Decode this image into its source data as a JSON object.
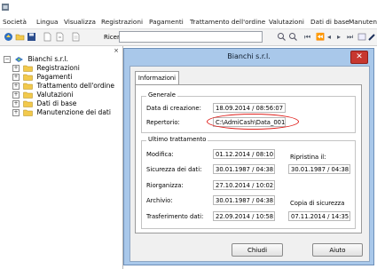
{
  "menu": {
    "items": [
      "Società",
      "Lingua",
      "Visualizza",
      "Registrazioni",
      "Pagamenti",
      "Trattamento dell'ordine",
      "Valutazioni",
      "Dati di base",
      "Manuten"
    ]
  },
  "toolbar": {
    "search_label": "Ricerca:",
    "search_value": ""
  },
  "sidebar": {
    "close": "×",
    "root_label": "Bianchi s.r.l.",
    "items": [
      {
        "label": "Registrazioni",
        "expander": "+"
      },
      {
        "label": "Pagamenti",
        "expander": "+"
      },
      {
        "label": "Trattamento dell'ordine",
        "expander": "+"
      },
      {
        "label": "Valutazioni",
        "expander": "+"
      },
      {
        "label": "Dati di base",
        "expander": "+"
      },
      {
        "label": "Manutenzione dei dati",
        "expander": "+"
      }
    ],
    "root_expander": "−"
  },
  "dialog": {
    "title": "Bianchi s.r.l.",
    "close": "✕",
    "tab_label": "Informazioni",
    "general": {
      "title": "Generale",
      "creation_label": "Data di creazione:",
      "creation_value": "18.09.2014 / 08:56:07",
      "repo_label": "Repertorio:",
      "repo_value": "C:\\AdmiCash\\Data_001"
    },
    "last": {
      "title": "Ultimo trattamento",
      "rows": [
        {
          "label": "Modifica:",
          "value": "01.12.2014 / 08:10:42"
        },
        {
          "label": "Sicurezza dei dati:",
          "value": "30.01.1987 / 04:38:08"
        },
        {
          "label": "Riorganizza:",
          "value": "27.10.2014 / 10:02:41"
        },
        {
          "label": "Archivio:",
          "value": "30.01.1987 / 04:38:08"
        },
        {
          "label": "Trasferimento dati:",
          "value": "22.09.2014 / 10:58:25"
        }
      ],
      "restore_label": "Ripristina il:",
      "restore_value": "30.01.1987 / 04:38:08",
      "backup_label": "Copia di sicurezza",
      "backup_value": "07.11.2014 / 14:35:09"
    },
    "buttons": {
      "close": "Chiudi",
      "help": "Aiuto"
    }
  },
  "colors": {
    "dialog_frame": "#a9c8ea",
    "close_button": "#c7372f",
    "highlight": "#e0201c",
    "folder": "#f2c94c"
  }
}
